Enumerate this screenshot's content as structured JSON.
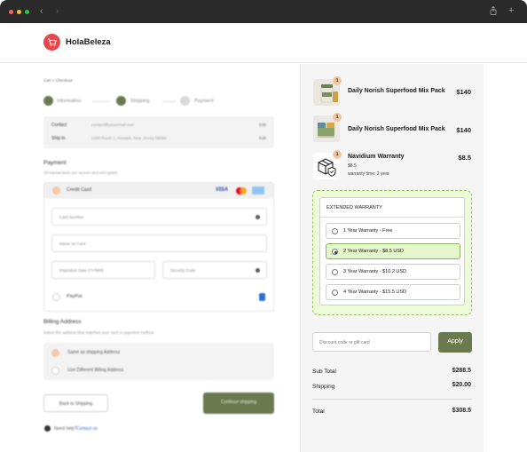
{
  "brand": {
    "name": "HolaBeleza",
    "accent": "#e5484d",
    "primary": "#6b7a4e"
  },
  "window": {
    "controls": [
      "close",
      "minimize",
      "maximize"
    ],
    "nav_icons": [
      "back-icon",
      "forward-icon"
    ],
    "right_icons": [
      "share-icon",
      "new-tab-icon"
    ]
  },
  "checkout_blurred": {
    "breadcrumb": "Cart > Checkout",
    "steps": [
      "Information",
      "Shipping",
      "Payment"
    ],
    "shipping_summary": [
      {
        "label": "Contact",
        "value": "contact@youremail.com",
        "action": "Edit"
      },
      {
        "label": "Ship to",
        "value": "2400 Route 1, Newark, New Jersey 08083",
        "action": "Edit"
      }
    ],
    "payment": {
      "title": "Payment",
      "subtitle": "All transactions are secure and encrypted",
      "credit_card_label": "Credit Card",
      "card_number_placeholder": "Card Number",
      "name_placeholder": "Name on Card",
      "expiry_placeholder": "Expiration Date (YY/MM)",
      "security_placeholder": "Security Code",
      "paypal_label": "PayPal"
    },
    "billing": {
      "title": "Billing Address",
      "subtitle": "Select the address that matches your card or payment method",
      "options": [
        "Same as shipping Address",
        "Use Different Billing Address"
      ]
    },
    "back_button": "Back to Shipping",
    "continue_button": "Continue shipping",
    "help_text": "Need help?",
    "help_link": "Contact us"
  },
  "order": {
    "items": [
      {
        "name": "Daily Norish Superfood Mix Pack",
        "price": "$140",
        "qty": "1",
        "icon": "supplement-jar-icon"
      },
      {
        "name": "Daily Norish Superfood Mix Pack",
        "price": "$140",
        "qty": "1",
        "icon": "supplement-pack-icon"
      },
      {
        "name": "Navidium Warranty",
        "price": "$8.5",
        "qty": "1",
        "sub_price": "$8.5",
        "note": "warranty time: 2 year",
        "icon": "shield-box-icon"
      }
    ],
    "extended_warranty": {
      "title": "EXTENDED WARRANTY",
      "selected_index": 1,
      "options": [
        "1 Year Warranty - Free",
        "2 Year Warranty - $8.5 USD",
        "3 Year Warranty - $10.2 USD",
        "4 Year Warranty - $15.5 USD"
      ]
    },
    "discount_placeholder": "Discount code or gift card",
    "apply_label": "Apply",
    "subtotal_label": "Sub Total",
    "subtotal": "$288.5",
    "shipping_label": "Shipping",
    "shipping": "$20.00",
    "total_label": "Total",
    "total": "$308.5"
  }
}
